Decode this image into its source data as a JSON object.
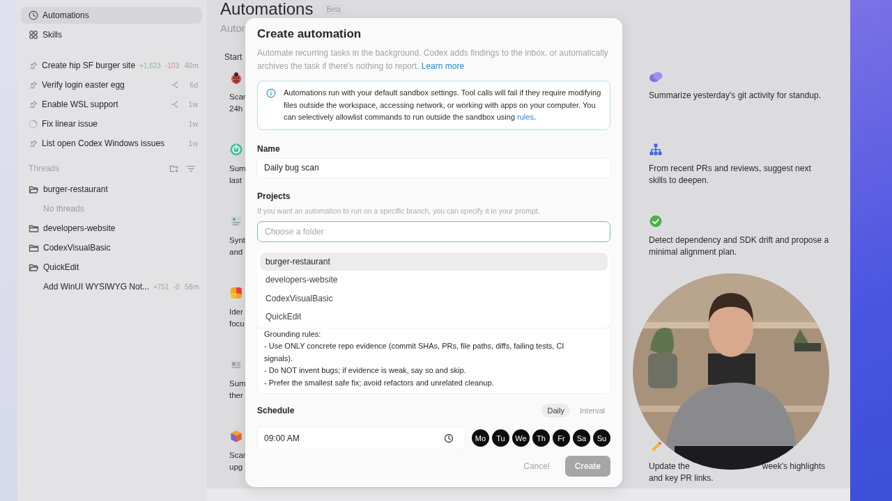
{
  "sidebar": {
    "nav": [
      {
        "label": "Automations",
        "selected": true
      },
      {
        "label": "Skills",
        "selected": false
      }
    ],
    "pinned": [
      {
        "kind": "pinned",
        "title": "Create hip SF burger site",
        "additions": "+1,623",
        "deletions": "-103",
        "branch": false,
        "time": "40m"
      },
      {
        "kind": "pinned",
        "title": "Verify login easter egg",
        "branch": true,
        "time": "6d"
      },
      {
        "kind": "pinned",
        "title": "Enable WSL support",
        "branch": true,
        "time": "1w"
      },
      {
        "kind": "running",
        "title": "Fix linear issue",
        "branch": false,
        "time": "1w"
      },
      {
        "kind": "pinned",
        "title": "List open Codex Windows issues",
        "branch": false,
        "time": "1w"
      }
    ],
    "threads_heading": "Threads",
    "projects": [
      {
        "name": "burger-restaurant",
        "expanded": true,
        "empty_note": "No threads"
      },
      {
        "name": "developers-website",
        "expanded": false
      },
      {
        "name": "CodexVisualBasic",
        "expanded": false
      },
      {
        "name": "QuickEdit",
        "expanded": true,
        "children": [
          {
            "title": "Add WinUI WYSIWYG Not...",
            "additions": "+751",
            "deletions": "-0",
            "time": "58m"
          }
        ]
      }
    ]
  },
  "main": {
    "title": "Automations",
    "badge": "Beta",
    "subtitle": "Autor",
    "section": "Start",
    "left_cards": [
      {
        "lines": [
          "Scar",
          "24h"
        ]
      },
      {
        "lines": [
          "Sum",
          "last"
        ]
      },
      {
        "lines": [
          "Synt",
          "and"
        ]
      },
      {
        "lines": [
          "Ider",
          "focu"
        ]
      },
      {
        "lines": [
          "Sum",
          "ther"
        ]
      },
      {
        "lines": [
          "Scar",
          "upg"
        ]
      }
    ],
    "right_cards": [
      {
        "text_parts": [
          "Summarize yesterday's git activity for standup."
        ]
      },
      {
        "text_parts": [
          "From recent PRs and reviews, suggest next skills to deepen."
        ]
      },
      {
        "text_parts": [
          "Detect dependency and SDK drift and propose a minimal alignment plan."
        ]
      },
      {
        "text_parts": [
          "Update the",
          "week's highlights",
          "and key PR links."
        ]
      }
    ]
  },
  "dialog": {
    "title": "Create automation",
    "description": "Automate recurring tasks in the background. Codex adds findings to the inbox, or automatically archives the task if there's nothing to report.",
    "description_link": "Learn more",
    "info_text": "Automations run with your default sandbox settings. Tool calls will fail if they require modifying files outside the workspace, accessing network, or working with apps on your computer. You can selectively allowlist commands to run outside the sandbox using",
    "info_link": "rules",
    "info_suffix": ".",
    "name_label": "Name",
    "name_value": "Daily bug scan",
    "projects_label": "Projects",
    "projects_hint": "If you want an automation to run on a specific branch, you can specify it in your prompt.",
    "projects_placeholder": "Choose a folder",
    "folder_options": [
      {
        "label": "burger-restaurant",
        "selected": true
      },
      {
        "label": "developers-website",
        "selected": false
      },
      {
        "label": "CodexVisualBasic",
        "selected": false
      },
      {
        "label": "QuickEdit",
        "selected": false
      }
    ],
    "prompt": "Grounding rules:\n- Use ONLY concrete repo evidence (commit SHAs, PRs, file paths, diffs, failing tests, CI signals).\n- Do NOT invent bugs; if evidence is weak, say so and skip.\n- Prefer the smallest safe fix; avoid refactors and unrelated cleanup.",
    "schedule_label": "Schedule",
    "schedule_modes": [
      {
        "label": "Daily",
        "selected": true
      },
      {
        "label": "Interval",
        "selected": false
      }
    ],
    "time": "09:00 AM",
    "days": [
      {
        "label": "Mo",
        "selected": true
      },
      {
        "label": "Tu",
        "selected": true
      },
      {
        "label": "We",
        "selected": true
      },
      {
        "label": "Th",
        "selected": true
      },
      {
        "label": "Fr",
        "selected": true
      },
      {
        "label": "Sa",
        "selected": true
      },
      {
        "label": "Su",
        "selected": true
      }
    ],
    "cancel": "Cancel",
    "create": "Create",
    "create_disabled": true
  }
}
